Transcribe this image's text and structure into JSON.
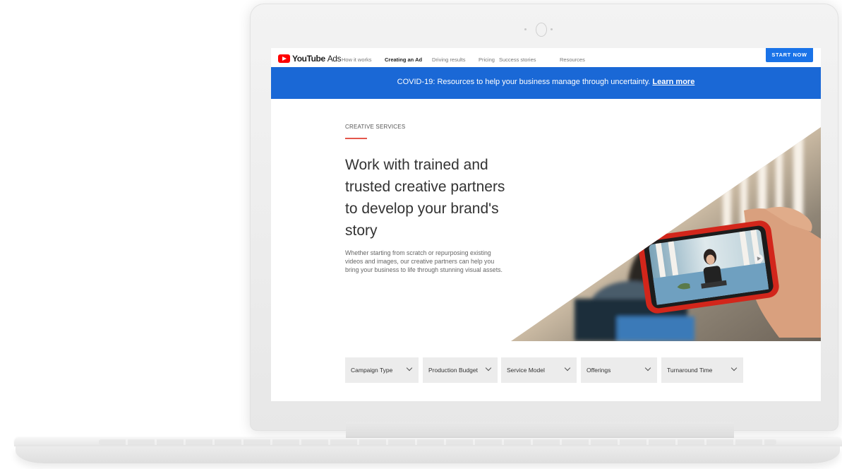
{
  "nav": {
    "logo_brand": "YouTube",
    "logo_suffix": "Ads",
    "links": [
      "How it works",
      "Creating an Ad",
      "Driving results",
      "Pricing",
      "Success stories",
      "Resources"
    ],
    "active_link": "Creating an Ad",
    "cta": "START NOW"
  },
  "banner": {
    "text": "COVID-19: Resources to help your business manage through uncertainty.",
    "link": "Learn more"
  },
  "hero": {
    "eyebrow": "CREATIVE SERVICES",
    "headline": "Work with trained and trusted creative partners to develop your brand's story",
    "description": "Whether starting from scratch or repurposing existing videos and images, our creative partners can help you bring your business to life through stunning visual assets."
  },
  "filters": [
    "Campaign Type",
    "Production Budget",
    "Service Model",
    "Offerings",
    "Turnaround Time"
  ],
  "colors": {
    "accent": "#1a73e8",
    "banner": "#1a68d6",
    "brand_red": "#ff0000",
    "eyebrow_rule": "#e4574c"
  },
  "icons": [
    "youtube-logo-icon",
    "chevron-down-icon",
    "play-icon",
    "camera-icon"
  ]
}
